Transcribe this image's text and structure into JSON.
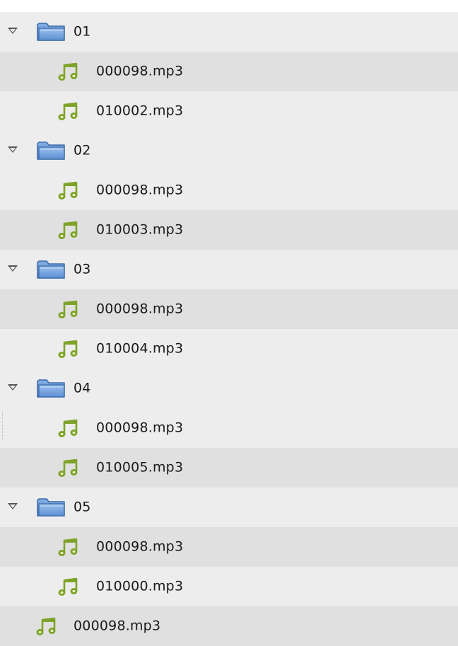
{
  "tree": [
    {
      "kind": "folder",
      "name": "01",
      "row": "odd"
    },
    {
      "kind": "child",
      "name": "000098.mp3",
      "row": "even"
    },
    {
      "kind": "child",
      "name": "010002.mp3",
      "row": "odd"
    },
    {
      "kind": "folder",
      "name": "02",
      "row": "odd"
    },
    {
      "kind": "child",
      "name": "000098.mp3",
      "row": "odd"
    },
    {
      "kind": "child",
      "name": "010003.mp3",
      "row": "even"
    },
    {
      "kind": "folder",
      "name": "03",
      "row": "odd"
    },
    {
      "kind": "child",
      "name": "000098.mp3",
      "row": "even"
    },
    {
      "kind": "child",
      "name": "010004.mp3",
      "row": "odd"
    },
    {
      "kind": "folder",
      "name": "04",
      "row": "odd"
    },
    {
      "kind": "child",
      "name": "000098.mp3",
      "row": "odd"
    },
    {
      "kind": "child",
      "name": "010005.mp3",
      "row": "even"
    },
    {
      "kind": "folder",
      "name": "05",
      "row": "odd"
    },
    {
      "kind": "child",
      "name": "000098.mp3",
      "row": "even"
    },
    {
      "kind": "child",
      "name": "010000.mp3",
      "row": "odd"
    },
    {
      "kind": "root",
      "name": "000098.mp3",
      "row": "even"
    }
  ],
  "colors": {
    "row_light": "#ededed",
    "row_dark": "#e0e0e0",
    "folder_blue": "#5e8fcf",
    "audio_green": "#7ea328"
  },
  "icons": {
    "folder": "folder-icon",
    "audio": "audio-file-icon",
    "expander": "expander-triangle-icon"
  }
}
